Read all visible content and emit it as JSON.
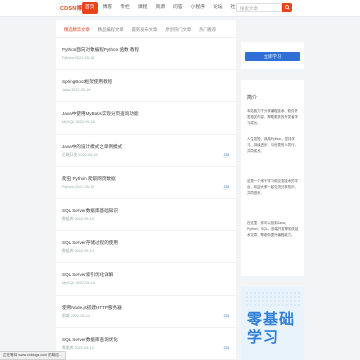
{
  "header": {
    "logo": "CDSN博客",
    "nav": [
      "首页",
      "博客",
      "专栏",
      "课程",
      "资源",
      "问答",
      "小程序",
      "论坛",
      "社区",
      "大数据",
      "IT技术"
    ],
    "search_placeholder": "搜索文章"
  },
  "tabs": [
    "精选精华文章",
    "精品编程文章",
    "最新发布文章",
    "原创热门文章",
    "热门推荐"
  ],
  "articles": [
    {
      "title": "Python面向对象编程Python 函数 教程",
      "meta": "Python  2022-05-16"
    },
    {
      "title": "SpringBoot框架使用教程",
      "meta": "Java  2022-05-16"
    },
    {
      "title": "Java中使用MyBatis实现分页查询功能",
      "meta": "MySQL  2022-05-16"
    },
    {
      "title": "Java中的设计模式之单例模式",
      "meta": "后端开发  2022-05-15",
      "badge": "234"
    },
    {
      "title": "爬虫 Python 爬取网页数据",
      "meta": "Python  2022-05-15",
      "badge": "234"
    },
    {
      "title": "SQL Server数据库基础知识",
      "meta": "数据库  2022-05-15"
    },
    {
      "title": "SQL Server存储过程的使用",
      "meta": "数据库  2022-05-14"
    },
    {
      "title": "SQL Server索引优化详解",
      "meta": "MySQL  2022-05-14"
    },
    {
      "title": "使用Node.js搭建HTTP服务器",
      "meta": "前端  2022-05-14",
      "badge": "234"
    },
    {
      "title": "SQL Server数据库查询优化",
      "meta": "数据库  2022-05-13",
      "badge": "234"
    }
  ],
  "sidebar": {
    "button": "立即学习",
    "title": "简介",
    "paragraphs": [
      "本站致力于分享编程技术、软件开发相关内容，帮助更多的开发者学习成长。",
      "人生苦短，我用Python。坚持学习、持续进步，与优秀的人同行，共同成长。",
      "这是一个用于学习和交流技术的平台，欢迎大家一起交流分享知识，共同进步。",
      "在这里，你可以找到Java、Python、SQL、前端开发等相关技术文章，帮助你提升编程能力。"
    ],
    "ad_text": "零基础\n学习"
  },
  "status": "正在等待 www.cnblogs.com 的响应..."
}
